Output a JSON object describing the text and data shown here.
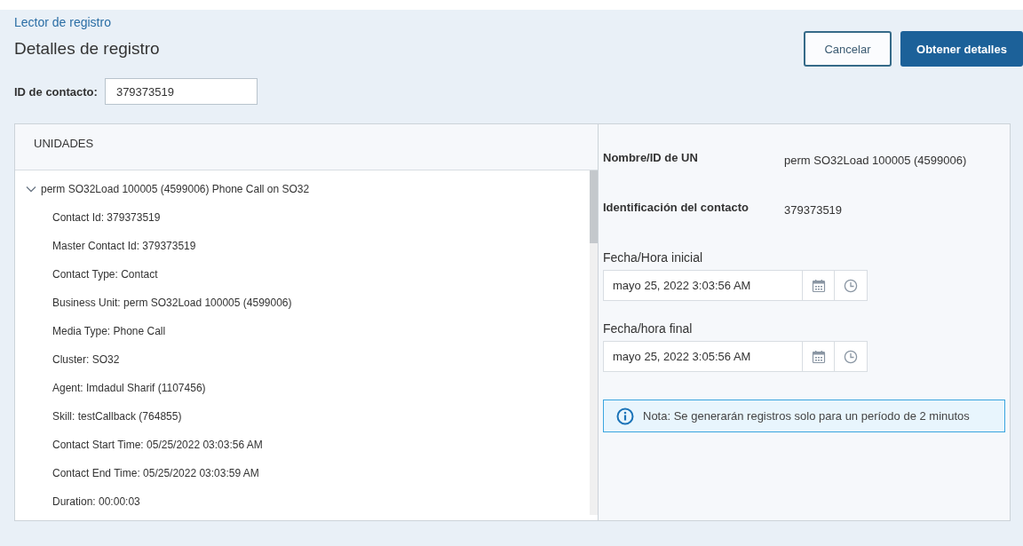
{
  "breadcrumb": "Lector de registro",
  "title": "Detalles de registro",
  "buttons": [
    {
      "label": "Cancelar",
      "kind": "secondary"
    },
    {
      "label": "Obtener detalles",
      "kind": "primary"
    }
  ],
  "contact_field": {
    "label": "ID de contacto:",
    "value": "379373519"
  },
  "units": {
    "heading": "UNIDADES",
    "tree": [
      {
        "label": "perm SO32Load 100005 (4599006) Phone Call on SO32",
        "expanded": true,
        "children": [
          {
            "label": "Contact Id: 379373519"
          },
          {
            "label": "Master Contact Id: 379373519"
          },
          {
            "label": "Contact Type: Contact"
          },
          {
            "label": "Business Unit: perm SO32Load 100005 (4599006)"
          },
          {
            "label": "Media Type: Phone Call"
          },
          {
            "label": "Cluster: SO32"
          },
          {
            "label": "Agent: Imdadul Sharif (1107456)"
          },
          {
            "label": "Skill: testCallback (764855)"
          },
          {
            "label": "Contact Start Time: 05/25/2022 03:03:56 AM"
          },
          {
            "label": "Contact End Time: 05/25/2022 03:03:59 AM"
          },
          {
            "label": "Duration: 00:00:03"
          }
        ]
      }
    ]
  },
  "details": [
    {
      "label": "Nombre/ID de UN",
      "value": "perm SO32Load 100005 (4599006)"
    },
    {
      "label": "Identificación del contacto",
      "value": "379373519"
    }
  ],
  "datetimes": [
    {
      "label": "Fecha/Hora inicial",
      "value": "mayo 25, 2022 3:03:56 AM"
    },
    {
      "label": "Fecha/hora final",
      "value": "mayo 25, 2022 3:05:56 AM"
    }
  ],
  "note": "Nota: Se generarán registros solo para un período de 2 minutos"
}
